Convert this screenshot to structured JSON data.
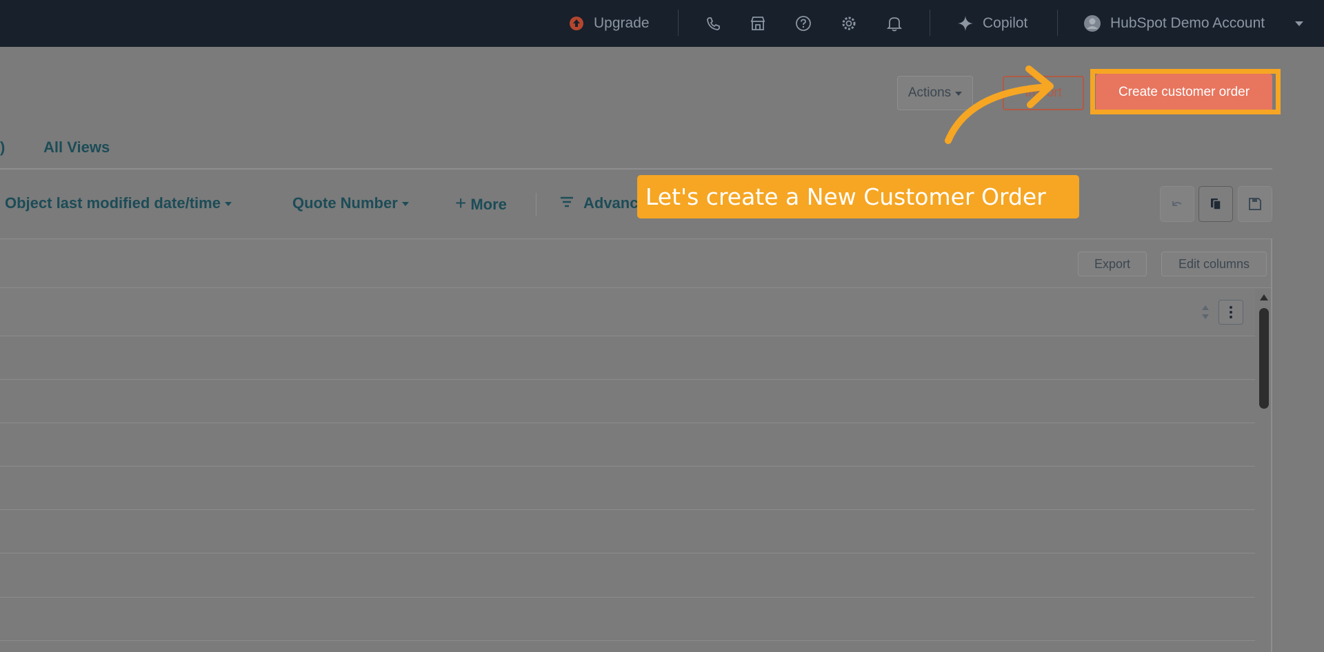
{
  "topbar": {
    "upgrade_label": "Upgrade",
    "copilot_label": "Copilot",
    "account_label": "HubSpot Demo Account",
    "icons": [
      "upgrade-icon",
      "phone-icon",
      "marketplace-icon",
      "help-icon",
      "settings-icon",
      "notifications-icon",
      "copilot-sparkle-icon",
      "avatar",
      "chevron-down-icon"
    ]
  },
  "header": {
    "actions_label": "Actions",
    "import_label": "Import",
    "create_label": "Create customer order"
  },
  "tabs": {
    "partial_label": ")",
    "all_views_label": "All Views"
  },
  "filters": {
    "modified_label": "Object last modified date/time",
    "quote_label": "Quote Number",
    "more_label": "More",
    "advanced_label": "Advanc"
  },
  "table_toolbar": {
    "export_label": "Export",
    "edit_columns_label": "Edit columns"
  },
  "callout": {
    "text": "Let's create a New Customer Order"
  },
  "colors": {
    "topbar": "#17202b",
    "overlay": "#7b7b7b",
    "accent": "#e8755e",
    "highlight": "#f6a623",
    "link": "#1c4c57"
  }
}
